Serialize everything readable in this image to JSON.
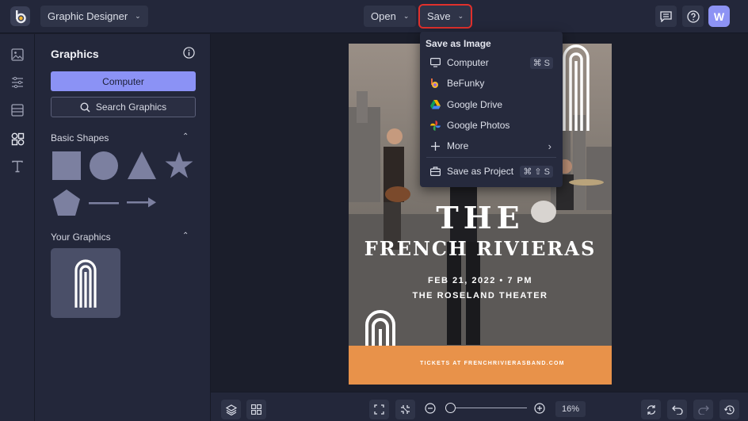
{
  "header": {
    "app_dropdown_label": "Graphic Designer",
    "open_label": "Open",
    "save_label": "Save",
    "avatar_initial": "W"
  },
  "panel": {
    "title": "Graphics",
    "computer_button": "Computer",
    "search_button": "Search Graphics",
    "basic_shapes_title": "Basic Shapes",
    "your_graphics_title": "Your Graphics"
  },
  "save_menu": {
    "header": "Save as Image",
    "items": [
      {
        "label": "Computer",
        "shortcut": "⌘ S",
        "icon": "monitor-icon"
      },
      {
        "label": "BeFunky",
        "shortcut": "",
        "icon": "befunky-icon"
      },
      {
        "label": "Google Drive",
        "shortcut": "",
        "icon": "google-drive-icon"
      },
      {
        "label": "Google Photos",
        "shortcut": "",
        "icon": "google-photos-icon"
      },
      {
        "label": "More",
        "shortcut": "",
        "icon": "plus-icon"
      },
      {
        "label": "Save as Project",
        "shortcut": "⌘ ⇧ S",
        "icon": "briefcase-icon"
      }
    ]
  },
  "poster": {
    "line1": "THE",
    "line2": "FRENCH RIVIERAS",
    "date": "FEB 21, 2022 • 7 PM",
    "venue": "THE ROSELAND THEATER",
    "tickets": "TICKETS AT FRENCHRIVIERASBAND.COM"
  },
  "zoom": {
    "value": "16%",
    "level_fraction": 0.03
  },
  "colors": {
    "accent": "#8b92f5",
    "save_highlight": "#e0302c",
    "poster_band": "#e8924a"
  }
}
